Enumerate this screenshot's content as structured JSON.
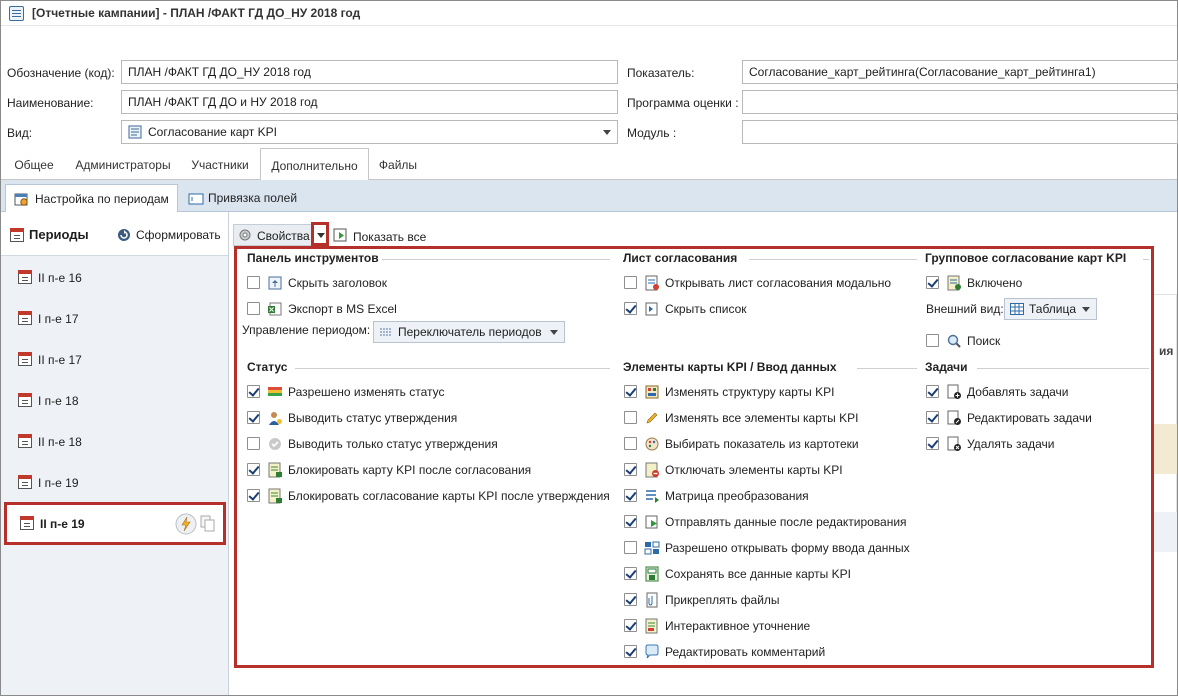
{
  "window": {
    "title": "[Отчетные кампании] - ПЛАН /ФАКТ ГД ДО_НУ 2018 год"
  },
  "form": {
    "code_label": "Обозначение (код):",
    "code_value": "ПЛАН /ФАКТ ГД ДО_НУ 2018 год",
    "name_label": "Наименование:",
    "name_value": "ПЛАН /ФАКТ ГД ДО и НУ 2018 год",
    "kind_label": "Вид:",
    "kind_value": "Согласование карт KPI",
    "indicator_label": "Показатель:",
    "indicator_value": "Согласование_карт_рейтинга(Согласование_карт_рейтинга1)",
    "program_label": "Программа оценки :",
    "program_value": "",
    "module_label": "Модуль :",
    "module_value": ""
  },
  "tabs": [
    "Общее",
    "Администраторы",
    "Участники",
    "Дополнительно",
    "Файлы"
  ],
  "subtabs": [
    "Настройка по периодам",
    "Привязка полей"
  ],
  "periods": {
    "title": "Периоды",
    "form_button": "Сформировать",
    "items": [
      "II п-е 16",
      "I п-е 17",
      "II п-е 17",
      "I п-е 18",
      "II п-е 18",
      "I п-е 19",
      "II п-е 19"
    ]
  },
  "toolbar": {
    "properties": "Свойства",
    "show_all": "Показать все"
  },
  "background_fragment": "ия",
  "popup": {
    "toolbar_group": {
      "title": "Панель инструментов",
      "items": [
        {
          "label": "Скрыть заголовок",
          "checked": false,
          "icon": "header-icon"
        },
        {
          "label": "Экспорт в MS Excel",
          "checked": false,
          "icon": "excel-icon"
        }
      ],
      "period_label": "Управление периодом:",
      "period_value": "Переключатель периодов"
    },
    "sheet_group": {
      "title": "Лист согласования",
      "items": [
        {
          "label": "Открывать лист согласования модально",
          "checked": false,
          "icon": "sheet-icon"
        },
        {
          "label": "Скрыть список",
          "checked": true,
          "icon": "list-icon"
        }
      ]
    },
    "group_approval": {
      "title": "Групповое согласование карт KPI",
      "enabled_label": "Включено",
      "enabled": true,
      "view_label": "Внешний вид:",
      "view_value": "Таблица",
      "search_label": "Поиск",
      "search": false
    },
    "status_group": {
      "title": "Статус",
      "items": [
        {
          "label": "Разрешено изменять статус",
          "checked": true,
          "icon": "status-icon"
        },
        {
          "label": "Выводить статус утверждения",
          "checked": true,
          "icon": "user-icon"
        },
        {
          "label": "Выводить только статус утверждения",
          "checked": false,
          "icon": "check-circle-icon"
        },
        {
          "label": "Блокировать карту KPI после согласования",
          "checked": true,
          "icon": "lock-card-icon"
        },
        {
          "label": "Блокировать согласование карты KPI после утверждения",
          "checked": true,
          "icon": "lock-approve-icon"
        }
      ]
    },
    "elements_group": {
      "title": "Элементы карты KPI / Ввод данных",
      "items": [
        {
          "label": "Изменять структуру карты KPI",
          "checked": true,
          "icon": "structure-icon"
        },
        {
          "label": "Изменять все элементы карты KPI",
          "checked": false,
          "icon": "pencil-icon"
        },
        {
          "label": "Выбирать показатель из картотеки",
          "checked": false,
          "icon": "palette-icon"
        },
        {
          "label": "Отключать элементы карты KPI",
          "checked": true,
          "icon": "disable-icon"
        },
        {
          "label": "Матрица преобразования",
          "checked": true,
          "icon": "matrix-icon"
        },
        {
          "label": "Отправлять данные после редактирования",
          "checked": true,
          "icon": "send-icon"
        },
        {
          "label": "Разрешено открывать форму ввода данных",
          "checked": false,
          "icon": "form-icon"
        },
        {
          "label": "Сохранять все данные карты KPI",
          "checked": true,
          "icon": "save-icon"
        },
        {
          "label": "Прикреплять файлы",
          "checked": true,
          "icon": "attach-icon"
        },
        {
          "label": "Интерактивное уточнение",
          "checked": true,
          "icon": "interactive-icon"
        },
        {
          "label": "Редактировать комментарий",
          "checked": true,
          "icon": "comment-icon"
        }
      ]
    },
    "tasks_group": {
      "title": "Задачи",
      "items": [
        {
          "label": "Добавлять задачи",
          "checked": true,
          "icon": "task-add-icon"
        },
        {
          "label": "Редактировать задачи",
          "checked": true,
          "icon": "task-edit-icon"
        },
        {
          "label": "Удалять задачи",
          "checked": true,
          "icon": "task-delete-icon"
        }
      ]
    }
  }
}
